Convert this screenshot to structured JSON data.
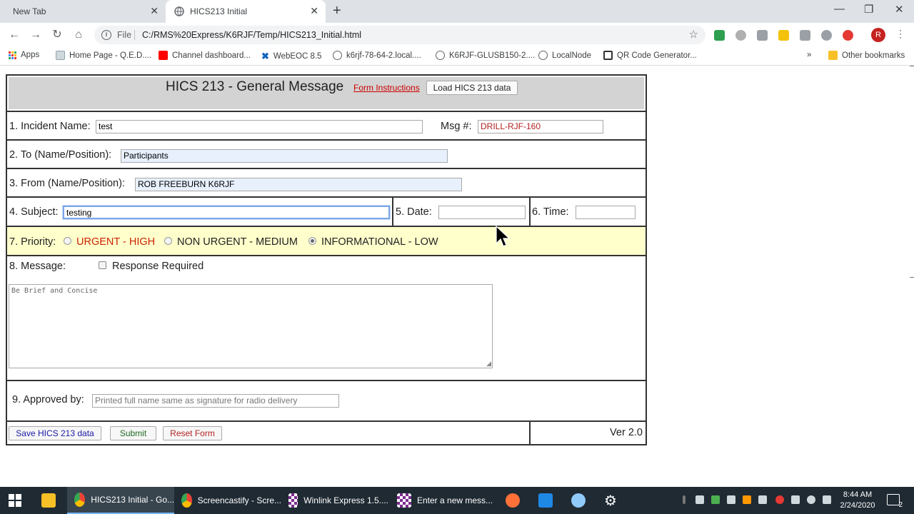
{
  "browser": {
    "tabs": [
      {
        "title": "New Tab"
      },
      {
        "title": "HICS213 Initial"
      }
    ],
    "address": {
      "scheme": "File",
      "url": "C:/RMS%20Express/K6RJF/Temp/HICS213_Initial.html"
    },
    "profile_initial": "R",
    "bookmarks": [
      {
        "label": "Apps",
        "icon": "apps-icon"
      },
      {
        "label": "Home Page - Q.E.D....",
        "icon": "page-icon"
      },
      {
        "label": "Channel dashboard...",
        "icon": "youtube-icon"
      },
      {
        "label": "WebEOC 8.5",
        "icon": "webeoc-icon"
      },
      {
        "label": "k6rjf-78-64-2.local....",
        "icon": "globe-icon"
      },
      {
        "label": "K6RJF-GLUSB150-2....",
        "icon": "globe-icon"
      },
      {
        "label": "LocalNode",
        "icon": "globe-icon"
      },
      {
        "label": "QR Code Generator...",
        "icon": "qr-icon"
      }
    ],
    "overflow": "»",
    "other_bookmarks": "Other bookmarks"
  },
  "form": {
    "title": "HICS 213 - General Message",
    "instructions_link": "Form Instructions",
    "load_button": "Load HICS 213 data",
    "incident_label": "1. Incident Name:",
    "incident_value": "test",
    "msg_label": "Msg #:",
    "msg_value": "DRILL-RJF-160",
    "to_label": "2. To (Name/Position):",
    "to_value": "Participants",
    "from_label": "3. From (Name/Position):",
    "from_value": "ROB FREEBURN K6RJF",
    "subject_label": "4. Subject:",
    "subject_value": "testing",
    "date_label": "5. Date:",
    "date_value": "",
    "time_label": "6. Time:",
    "time_value": "",
    "priority_label": "7. Priority:",
    "priority_options": [
      {
        "label": "URGENT - HIGH",
        "selected": false,
        "color": "#cc2200"
      },
      {
        "label": "NON URGENT - MEDIUM",
        "selected": false,
        "color": "#222222"
      },
      {
        "label": "INFORMATIONAL - LOW",
        "selected": true,
        "color": "#222222"
      }
    ],
    "message_label": "8. Message:",
    "response_required_label": "Response Required",
    "response_required": false,
    "message_placeholder": "Be Brief and Concise",
    "approved_label": "9. Approved by:",
    "approved_placeholder": "Printed full name same as signature for radio delivery",
    "save_button": "Save HICS 213 data",
    "submit_button": "Submit",
    "reset_button": "Reset Form",
    "version": "Ver 2.0"
  },
  "taskbar": {
    "items": [
      {
        "label": "HICS213 Initial - Go...",
        "icon": "chrome-icon",
        "active": true
      },
      {
        "label": "Screencastify - Scre...",
        "icon": "chrome-icon",
        "active": false
      },
      {
        "label": "Winlink Express 1.5....",
        "icon": "winlink-icon",
        "active": false
      },
      {
        "label": "Enter a new mess...",
        "icon": "winlink-icon",
        "active": false
      }
    ],
    "clock_time": "8:44 AM",
    "clock_date": "2/24/2020",
    "notification_count": "2"
  },
  "colors": {
    "priority_row_bg": "#ffffcc",
    "header_bg": "#d3d3d3",
    "link": "#cc0000"
  }
}
